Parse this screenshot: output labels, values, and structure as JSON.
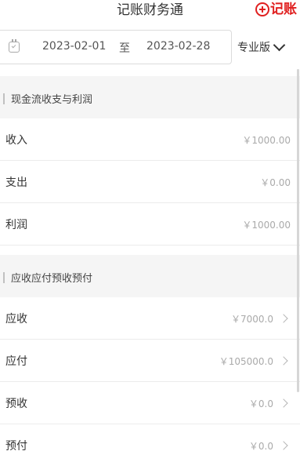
{
  "header": {
    "title": "记账财务通",
    "add_label": "记账"
  },
  "date_range": {
    "start": "2023-02-01",
    "separator": "至",
    "end": "2023-02-28"
  },
  "version_select": {
    "selected": "专业版"
  },
  "sections": [
    {
      "title": "现金流收支与利润",
      "rows": [
        {
          "label": "收入",
          "amount": "￥1000.00"
        },
        {
          "label": "支出",
          "amount": "￥0.00"
        },
        {
          "label": "利润",
          "amount": "￥1000.00"
        }
      ]
    },
    {
      "title": "应收应付预收预付",
      "rows": [
        {
          "label": "应收",
          "amount": "￥7000.0"
        },
        {
          "label": "应付",
          "amount": "￥105000.0"
        },
        {
          "label": "预收",
          "amount": "￥0.0"
        },
        {
          "label": "预付",
          "amount": "￥0.0"
        }
      ]
    }
  ],
  "icons": {
    "calendar": "calendar-icon",
    "add": "plus-circle-icon",
    "dropdown": "chevron-down-icon",
    "row_arrow": "chevron-right-icon"
  },
  "colors": {
    "accent": "#e02020",
    "amount_text": "#aaaaaa",
    "section_bg": "#f5f5f5"
  }
}
